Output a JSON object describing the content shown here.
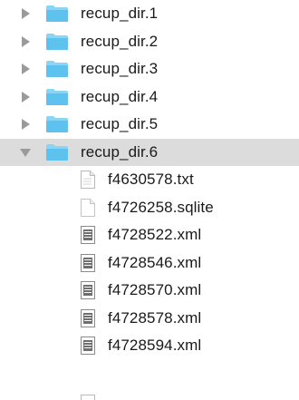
{
  "folders": [
    {
      "name": "recup_dir.1",
      "expanded": false
    },
    {
      "name": "recup_dir.2",
      "expanded": false
    },
    {
      "name": "recup_dir.3",
      "expanded": false
    },
    {
      "name": "recup_dir.4",
      "expanded": false
    },
    {
      "name": "recup_dir.5",
      "expanded": false
    },
    {
      "name": "recup_dir.6",
      "expanded": true,
      "selected": true
    }
  ],
  "files": [
    {
      "name": "f4630578.txt",
      "icon": "text-document-icon"
    },
    {
      "name": "f4726258.sqlite",
      "icon": "blank-document-icon"
    },
    {
      "name": "f4728522.xml",
      "icon": "xml-document-icon"
    },
    {
      "name": "f4728546.xml",
      "icon": "xml-document-icon"
    },
    {
      "name": "f4728570.xml",
      "icon": "xml-document-icon"
    },
    {
      "name": "f4728578.xml",
      "icon": "xml-document-icon"
    },
    {
      "name": "f4728594.xml",
      "icon": "xml-document-icon"
    }
  ],
  "colors": {
    "folder": "#5ec2ef",
    "folder_tab": "#8ad4f5",
    "selected_row": "#dcdcdc",
    "disclosure": "#9a9a9a"
  }
}
